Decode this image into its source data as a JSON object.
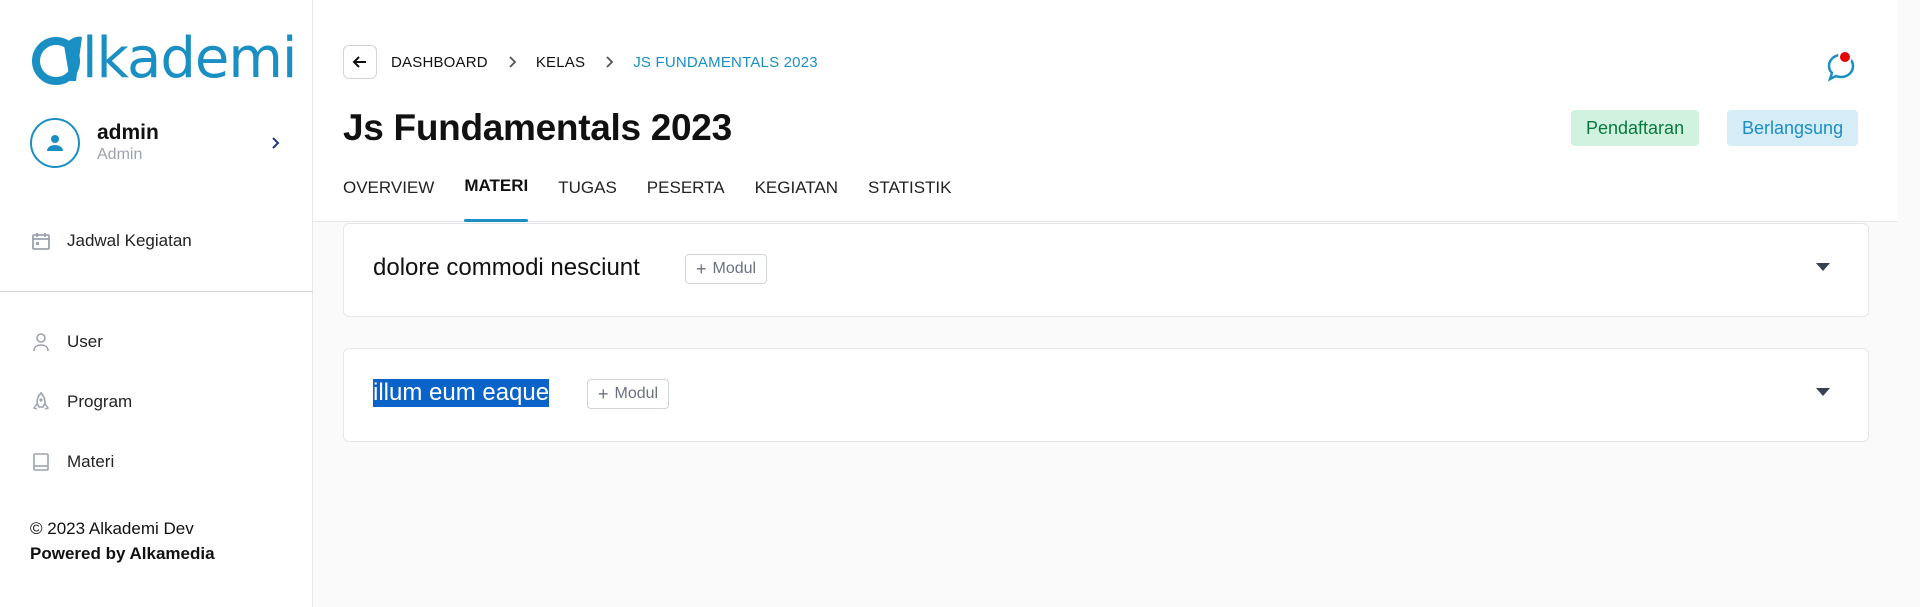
{
  "brand": {
    "name": "lkademi",
    "accent": "#1a8fc4"
  },
  "user": {
    "name": "admin",
    "role": "Admin"
  },
  "sidebar": {
    "top_items": [
      {
        "label": "Jadwal Kegiatan",
        "icon": "calendar-icon"
      }
    ],
    "items": [
      {
        "label": "User",
        "icon": "user-icon"
      },
      {
        "label": "Program",
        "icon": "rocket-icon"
      },
      {
        "label": "Materi",
        "icon": "book-icon"
      }
    ],
    "footer": {
      "copyright": "© 2023 Alkademi Dev",
      "powered": "Powered by Alkamedia"
    }
  },
  "header": {
    "breadcrumbs": [
      "DASHBOARD",
      "KELAS",
      "JS FUNDAMENTALS 2023"
    ],
    "title": "Js Fundamentals 2023",
    "badges": [
      "Pendaftaran",
      "Berlangsung"
    ],
    "tabs": [
      "OVERVIEW",
      "MATERI",
      "TUGAS",
      "PESERTA",
      "KEGIATAN",
      "STATISTIK"
    ],
    "active_tab": "MATERI"
  },
  "sections": [
    {
      "title": "dolore commodi nesciunt",
      "button": "Modul",
      "selected": false
    },
    {
      "title": "illum eum eaque",
      "button": "Modul",
      "selected": true
    }
  ]
}
